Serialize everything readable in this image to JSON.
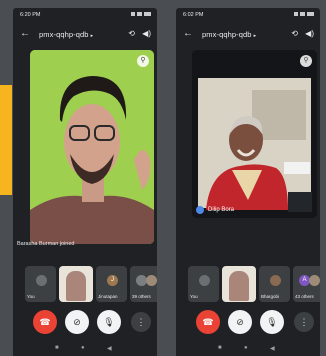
{
  "phones": [
    {
      "time": "6:20 PM",
      "meeting_code": "pmx-qqhp-qdb",
      "caret": "▸",
      "joined_text": "Barasha Burman joined",
      "thumbs": [
        {
          "label": "You"
        },
        {
          "label": ""
        },
        {
          "label": "J",
          "sublabel": "Jinutapan"
        },
        {
          "label": "39 others"
        }
      ]
    },
    {
      "time": "6:02 PM",
      "meeting_code": "pmx-qqhp-qdb",
      "caret": "▸",
      "speaker_name": "Dilip Bora",
      "thumbs": [
        {
          "label": "You"
        },
        {
          "label": ""
        },
        {
          "label": "Bhargobi"
        },
        {
          "label": "A",
          "sublabel": "43 others"
        }
      ]
    }
  ],
  "icons": {
    "back": "←",
    "switch_camera": "⟲",
    "speaker": "◀)",
    "pin": "⚲",
    "end_call": "☎",
    "video_off": "⊘",
    "mic_off": "🎙",
    "more": "⋮",
    "nav_square": "■",
    "nav_circle": "●",
    "nav_back": "◀"
  },
  "colors": {
    "background": "#4a4e52",
    "accent_yellow": "#f6b51e",
    "end_call_red": "#ea4335",
    "tile_green": "#9fcf4f"
  }
}
